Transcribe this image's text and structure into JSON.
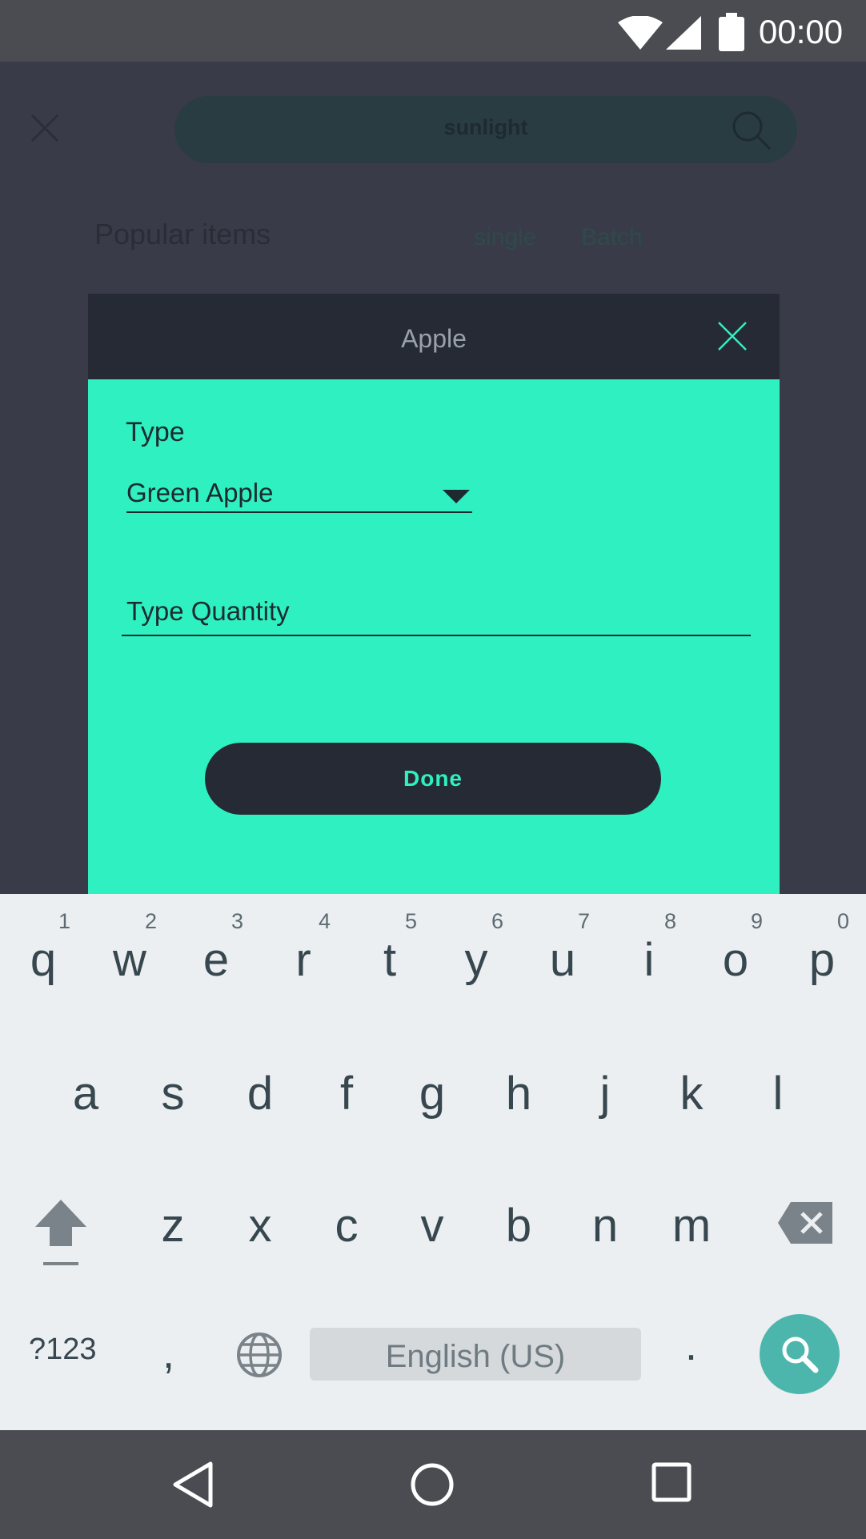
{
  "status_bar": {
    "time": "00:00"
  },
  "background_screen": {
    "search_text": "sunlight",
    "section_title": "Popular items",
    "tab_single": "single",
    "tab_batch": "Batch"
  },
  "dialog": {
    "title": "Apple",
    "type_label": "Type",
    "type_value": "Green Apple",
    "quantity_placeholder": "Type Quantity",
    "done_label": "Done"
  },
  "keyboard": {
    "row1": [
      {
        "ch": "q",
        "num": "1"
      },
      {
        "ch": "w",
        "num": "2"
      },
      {
        "ch": "e",
        "num": "3"
      },
      {
        "ch": "r",
        "num": "4"
      },
      {
        "ch": "t",
        "num": "5"
      },
      {
        "ch": "y",
        "num": "6"
      },
      {
        "ch": "u",
        "num": "7"
      },
      {
        "ch": "i",
        "num": "8"
      },
      {
        "ch": "o",
        "num": "9"
      },
      {
        "ch": "p",
        "num": "0"
      }
    ],
    "row2": [
      "a",
      "s",
      "d",
      "f",
      "g",
      "h",
      "j",
      "k",
      "l"
    ],
    "row3": [
      "z",
      "x",
      "c",
      "v",
      "b",
      "n",
      "m"
    ],
    "symbols_label": "?123",
    "comma": ",",
    "space_label": "English (US)",
    "period": "."
  },
  "colors": {
    "accent": "#2ef0c0",
    "dialog_header": "#262a35",
    "keyboard_bg": "#eceff1",
    "search_key": "#4db6ac"
  },
  "icons": [
    "wifi-icon",
    "signal-icon",
    "battery-icon",
    "close-icon",
    "search-icon",
    "dropdown-arrow-icon",
    "shift-icon",
    "backspace-icon",
    "globe-icon",
    "back-icon",
    "home-icon",
    "recent-apps-icon"
  ]
}
